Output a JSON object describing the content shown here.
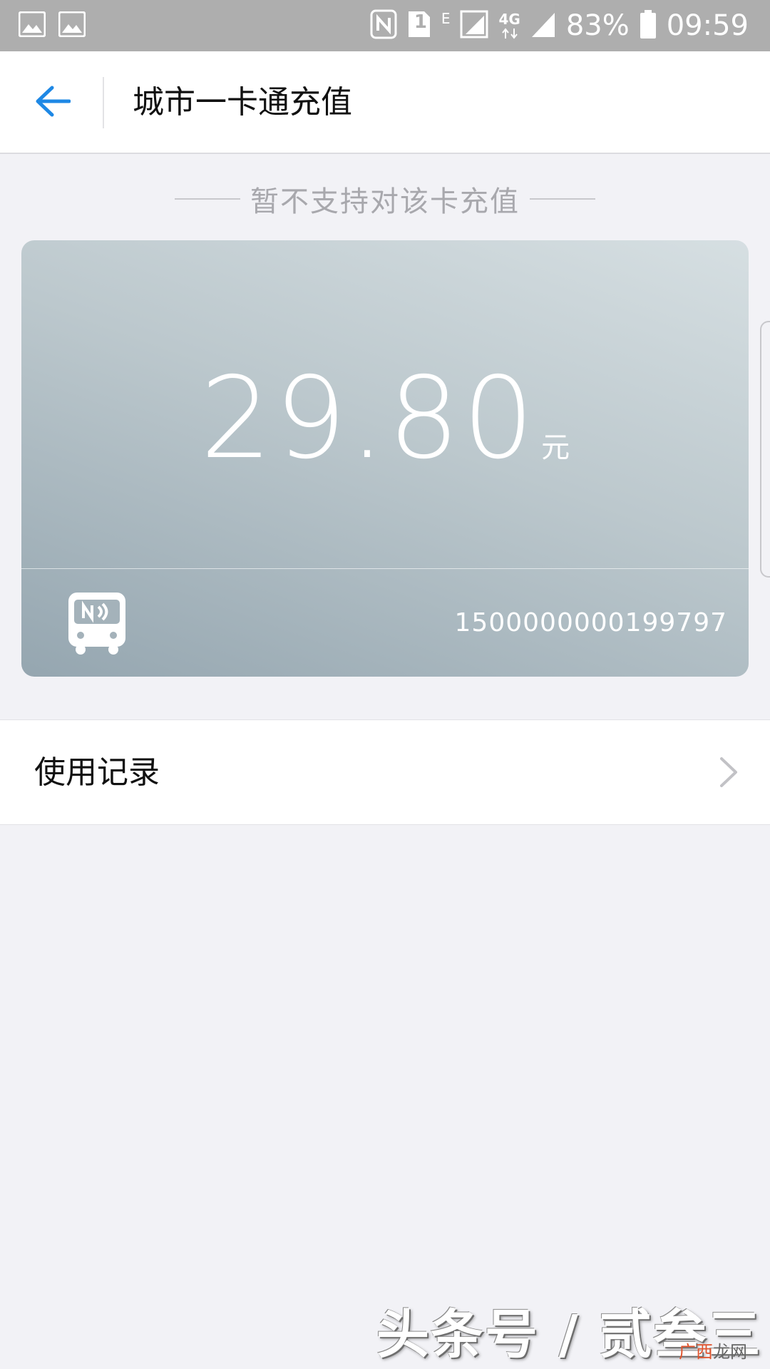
{
  "status_bar": {
    "battery": "83%",
    "time": "09:59",
    "sim_slot": "1",
    "network_e": "E",
    "network_4g": "4G"
  },
  "header": {
    "title": "城市一卡通充值"
  },
  "notice": {
    "text": "暂不支持对该卡充值"
  },
  "card": {
    "balance": "29.80",
    "unit": "元",
    "number": "1500000000199797"
  },
  "menu": {
    "usage_record": "使用记录"
  },
  "watermark": {
    "text": "头条号 / 贰叁三",
    "site_a": "广西",
    "site_b": "龙网"
  },
  "colors": {
    "accent": "#1e88e5",
    "status_bar": "#aeaeae",
    "background": "#f2f2f6"
  }
}
